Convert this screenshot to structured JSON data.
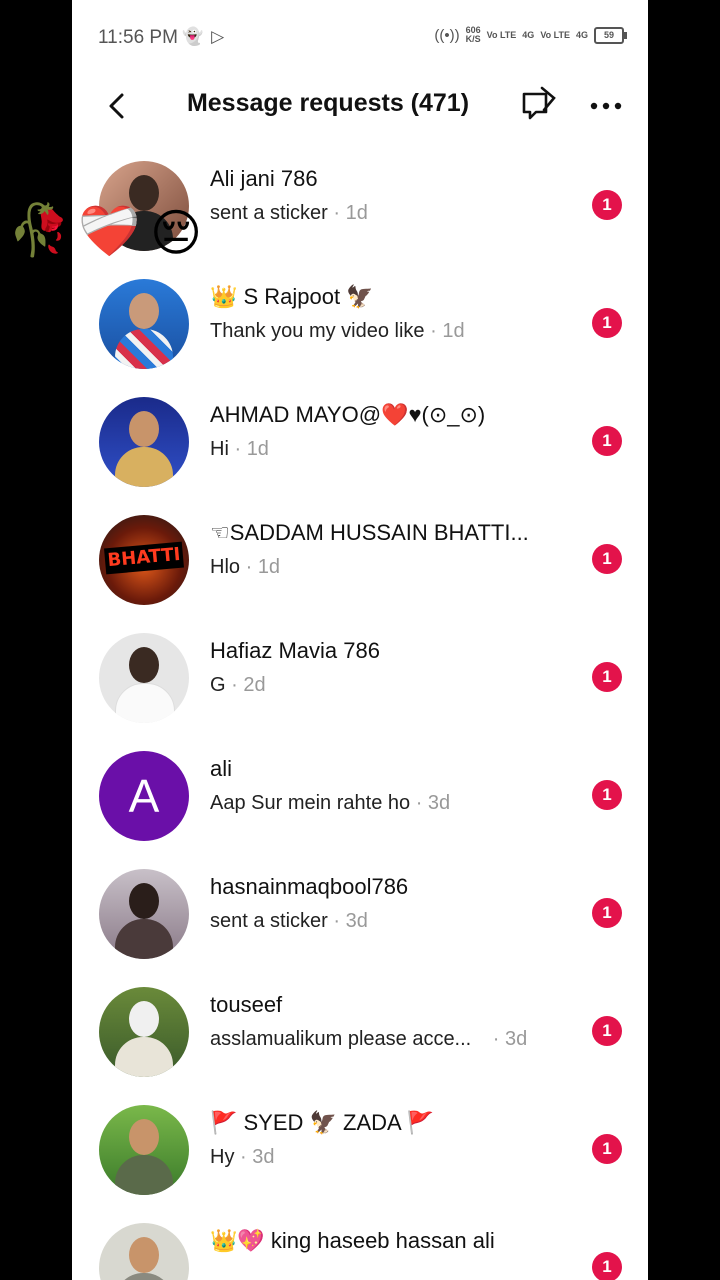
{
  "status_bar": {
    "time": "11:56 PM",
    "net_speed_top": "606",
    "net_speed_bottom": "K/S",
    "sim1": "Vo LTE",
    "sim1_gen": "4G",
    "sim2": "Vo LTE",
    "sim2_gen": "4G",
    "battery": "59"
  },
  "header": {
    "title": "Message requests (471)"
  },
  "colors": {
    "badge": "#e3134b",
    "letter_avatar": "#6a0fa8"
  },
  "requests": [
    {
      "name": "Ali jani 786",
      "preview": "sent a sticker",
      "ago": "1d",
      "unread": "1"
    },
    {
      "name": "👑 S Rajpoot 🦅",
      "preview": "Thank you my video like",
      "ago": "1d",
      "unread": "1"
    },
    {
      "name": "AHMAD MAYO@❤️♥(⊙_⊙)",
      "preview": "Hi",
      "ago": "1d",
      "unread": "1"
    },
    {
      "name": "☜SADDAM HUSSAIN BHATTI...",
      "preview": "Hlo",
      "ago": "1d",
      "unread": "1",
      "avatar_text": "BHATTI"
    },
    {
      "name": "Hafiaz  Mavia 786",
      "preview": "G",
      "ago": "2d",
      "unread": "1"
    },
    {
      "name": "ali",
      "preview": "Aap Sur mein rahte ho",
      "ago": "3d",
      "unread": "1",
      "avatar_letter": "A"
    },
    {
      "name": "hasnainmaqbool786",
      "preview": "sent a sticker",
      "ago": "3d",
      "unread": "1"
    },
    {
      "name": "touseef",
      "preview": "asslamualikum please acce...",
      "ago": "3d",
      "unread": "1"
    },
    {
      "name": "🚩 SYED 🦅 ZADA 🚩",
      "preview": "Hy",
      "ago": "3d",
      "unread": "1"
    },
    {
      "name": "👑💖 king haseeb hassan ali",
      "preview": "",
      "ago": "",
      "unread": "1"
    }
  ]
}
